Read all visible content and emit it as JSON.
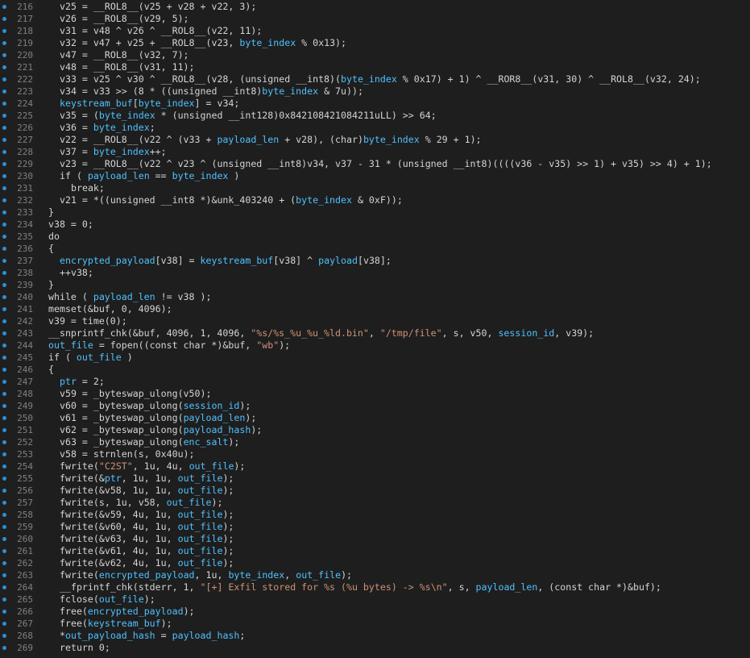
{
  "editor": {
    "colors": {
      "background": "#1e1e1e",
      "default_text": "#d4d4d4",
      "variable_highlight": "#4fc1ff",
      "string_literal": "#ce9178",
      "line_number": "#808080",
      "breakpoint_dot": "#2d8fd5"
    },
    "gutter_marker_icon": "dot-icon",
    "lines": [
      {
        "num": "216",
        "indent": 1,
        "segs": [
          [
            "",
            "v25 = __ROL8__(v25 + v28 + v22, 3);"
          ]
        ]
      },
      {
        "num": "217",
        "indent": 1,
        "segs": [
          [
            "",
            "v26 = __ROL8__(v29, 5);"
          ]
        ]
      },
      {
        "num": "218",
        "indent": 1,
        "segs": [
          [
            "",
            "v31 = v48 ^ v26 ^ __ROL8__(v22, 11);"
          ]
        ]
      },
      {
        "num": "219",
        "indent": 1,
        "segs": [
          [
            "",
            "v32 = v47 + v25 + __ROL8__(v23, "
          ],
          [
            "v",
            "byte_index"
          ],
          [
            "",
            " % 0x13);"
          ]
        ]
      },
      {
        "num": "220",
        "indent": 1,
        "segs": [
          [
            "",
            "v47 = __ROL8__(v32, 7);"
          ]
        ]
      },
      {
        "num": "221",
        "indent": 1,
        "segs": [
          [
            "",
            "v48 = __ROL8__(v31, 11);"
          ]
        ]
      },
      {
        "num": "222",
        "indent": 1,
        "segs": [
          [
            "",
            "v33 = v25 ^ v30 ^ __ROL8__(v28, (unsigned __int8)("
          ],
          [
            "v",
            "byte_index"
          ],
          [
            "",
            " % 0x17) + 1) ^ __ROR8__(v31, 30) ^ __ROL8__(v32, 24);"
          ]
        ]
      },
      {
        "num": "223",
        "indent": 1,
        "segs": [
          [
            "",
            "v34 = v33 >> (8 * ((unsigned __int8)"
          ],
          [
            "v",
            "byte_index"
          ],
          [
            "",
            " & 7u));"
          ]
        ]
      },
      {
        "num": "224",
        "indent": 1,
        "segs": [
          [
            "v",
            "keystream_buf"
          ],
          [
            "",
            "["
          ],
          [
            "v",
            "byte_index"
          ],
          [
            "",
            "] = v34;"
          ]
        ]
      },
      {
        "num": "225",
        "indent": 1,
        "segs": [
          [
            "",
            "v35 = ("
          ],
          [
            "v",
            "byte_index"
          ],
          [
            "",
            " * (unsigned __int128)0x842108421084211uLL) >> 64;"
          ]
        ]
      },
      {
        "num": "226",
        "indent": 1,
        "segs": [
          [
            "",
            "v36 = "
          ],
          [
            "v",
            "byte_index"
          ],
          [
            "",
            ";"
          ]
        ]
      },
      {
        "num": "227",
        "indent": 1,
        "segs": [
          [
            "",
            "v22 = __ROL8__(v22 ^ (v33 + "
          ],
          [
            "v",
            "payload_len"
          ],
          [
            "",
            " + v28), (char)"
          ],
          [
            "v",
            "byte_index"
          ],
          [
            "",
            " % 29 + 1);"
          ]
        ]
      },
      {
        "num": "228",
        "indent": 1,
        "segs": [
          [
            "",
            "v37 = "
          ],
          [
            "v",
            "byte_index"
          ],
          [
            "",
            "++;"
          ]
        ]
      },
      {
        "num": "229",
        "indent": 1,
        "segs": [
          [
            "",
            "v23 = __ROL8__(v22 ^ v23 ^ (unsigned __int8)v34, v37 - 31 * (unsigned __int8)((((v36 - v35) >> 1) + v35) >> 4) + 1);"
          ]
        ]
      },
      {
        "num": "230",
        "indent": 1,
        "segs": [
          [
            "",
            "if ( "
          ],
          [
            "v",
            "payload_len"
          ],
          [
            "",
            " == "
          ],
          [
            "v",
            "byte_index"
          ],
          [
            "",
            " )"
          ]
        ]
      },
      {
        "num": "231",
        "indent": 2,
        "segs": [
          [
            "",
            "break;"
          ]
        ]
      },
      {
        "num": "232",
        "indent": 1,
        "segs": [
          [
            "",
            "v21 = *((unsigned __int8 *)&unk_403240 + ("
          ],
          [
            "v",
            "byte_index"
          ],
          [
            "",
            " & 0xF));"
          ]
        ]
      },
      {
        "num": "233",
        "indent": 0,
        "segs": [
          [
            "",
            "}"
          ]
        ]
      },
      {
        "num": "234",
        "indent": 0,
        "segs": [
          [
            "",
            "v38 = 0;"
          ]
        ]
      },
      {
        "num": "235",
        "indent": 0,
        "segs": [
          [
            "",
            "do"
          ]
        ]
      },
      {
        "num": "236",
        "indent": 0,
        "segs": [
          [
            "",
            "{"
          ]
        ]
      },
      {
        "num": "237",
        "indent": 1,
        "segs": [
          [
            "v",
            "encrypted_payload"
          ],
          [
            "",
            "[v38] = "
          ],
          [
            "v",
            "keystream_buf"
          ],
          [
            "",
            "[v38] ^ "
          ],
          [
            "v",
            "payload"
          ],
          [
            "",
            "[v38];"
          ]
        ]
      },
      {
        "num": "238",
        "indent": 1,
        "segs": [
          [
            "",
            "++v38;"
          ]
        ]
      },
      {
        "num": "239",
        "indent": 0,
        "segs": [
          [
            "",
            "}"
          ]
        ]
      },
      {
        "num": "240",
        "indent": 0,
        "segs": [
          [
            "",
            "while ( "
          ],
          [
            "v",
            "payload_len"
          ],
          [
            "",
            " != v38 );"
          ]
        ]
      },
      {
        "num": "241",
        "indent": 0,
        "segs": [
          [
            "",
            "memset(&buf, 0, 4096);"
          ]
        ]
      },
      {
        "num": "242",
        "indent": 0,
        "segs": [
          [
            "",
            "v39 = time(0);"
          ]
        ]
      },
      {
        "num": "243",
        "indent": 0,
        "segs": [
          [
            "",
            "__snprintf_chk(&buf, 4096, 1, 4096, "
          ],
          [
            "s",
            "\"%s/%s_%u_%u_%ld.bin\""
          ],
          [
            "",
            ", "
          ],
          [
            "s",
            "\"/tmp/file\""
          ],
          [
            "",
            ", s, v50, "
          ],
          [
            "v",
            "session_id"
          ],
          [
            "",
            ", v39);"
          ]
        ]
      },
      {
        "num": "244",
        "indent": 0,
        "segs": [
          [
            "v",
            "out_file"
          ],
          [
            "",
            " = fopen((const char *)&buf, "
          ],
          [
            "s",
            "\"wb\""
          ],
          [
            "",
            ");"
          ]
        ]
      },
      {
        "num": "245",
        "indent": 0,
        "segs": [
          [
            "",
            "if ( "
          ],
          [
            "v",
            "out_file"
          ],
          [
            "",
            " )"
          ]
        ]
      },
      {
        "num": "246",
        "indent": 0,
        "segs": [
          [
            "",
            "{"
          ]
        ]
      },
      {
        "num": "247",
        "indent": 1,
        "segs": [
          [
            "v",
            "ptr"
          ],
          [
            "",
            " = 2;"
          ]
        ]
      },
      {
        "num": "248",
        "indent": 1,
        "segs": [
          [
            "",
            "v59 = _byteswap_ulong(v50);"
          ]
        ]
      },
      {
        "num": "249",
        "indent": 1,
        "segs": [
          [
            "",
            "v60 = _byteswap_ulong("
          ],
          [
            "v",
            "session_id"
          ],
          [
            "",
            ");"
          ]
        ]
      },
      {
        "num": "250",
        "indent": 1,
        "segs": [
          [
            "",
            "v61 = _byteswap_ulong("
          ],
          [
            "v",
            "payload_len"
          ],
          [
            "",
            ");"
          ]
        ]
      },
      {
        "num": "251",
        "indent": 1,
        "segs": [
          [
            "",
            "v62 = _byteswap_ulong("
          ],
          [
            "v",
            "payload_hash"
          ],
          [
            "",
            ");"
          ]
        ]
      },
      {
        "num": "252",
        "indent": 1,
        "segs": [
          [
            "",
            "v63 = _byteswap_ulong("
          ],
          [
            "v",
            "enc_salt"
          ],
          [
            "",
            ");"
          ]
        ]
      },
      {
        "num": "253",
        "indent": 1,
        "segs": [
          [
            "",
            "v58 = strnlen(s, 0x40u);"
          ]
        ]
      },
      {
        "num": "254",
        "indent": 1,
        "segs": [
          [
            "",
            "fwrite("
          ],
          [
            "s",
            "\"C2ST\""
          ],
          [
            "",
            ", 1u, 4u, "
          ],
          [
            "v",
            "out_file"
          ],
          [
            "",
            ");"
          ]
        ]
      },
      {
        "num": "255",
        "indent": 1,
        "segs": [
          [
            "",
            "fwrite(&"
          ],
          [
            "v",
            "ptr"
          ],
          [
            "",
            ", 1u, 1u, "
          ],
          [
            "v",
            "out_file"
          ],
          [
            "",
            ");"
          ]
        ]
      },
      {
        "num": "256",
        "indent": 1,
        "segs": [
          [
            "",
            "fwrite(&v58, 1u, 1u, "
          ],
          [
            "v",
            "out_file"
          ],
          [
            "",
            ");"
          ]
        ]
      },
      {
        "num": "257",
        "indent": 1,
        "segs": [
          [
            "",
            "fwrite(s, 1u, v58, "
          ],
          [
            "v",
            "out_file"
          ],
          [
            "",
            ");"
          ]
        ]
      },
      {
        "num": "258",
        "indent": 1,
        "segs": [
          [
            "",
            "fwrite(&v59, 4u, 1u, "
          ],
          [
            "v",
            "out_file"
          ],
          [
            "",
            ");"
          ]
        ]
      },
      {
        "num": "259",
        "indent": 1,
        "segs": [
          [
            "",
            "fwrite(&v60, 4u, 1u, "
          ],
          [
            "v",
            "out_file"
          ],
          [
            "",
            ");"
          ]
        ]
      },
      {
        "num": "260",
        "indent": 1,
        "segs": [
          [
            "",
            "fwrite(&v63, 4u, 1u, "
          ],
          [
            "v",
            "out_file"
          ],
          [
            "",
            ");"
          ]
        ]
      },
      {
        "num": "261",
        "indent": 1,
        "segs": [
          [
            "",
            "fwrite(&v61, 4u, 1u, "
          ],
          [
            "v",
            "out_file"
          ],
          [
            "",
            ");"
          ]
        ]
      },
      {
        "num": "262",
        "indent": 1,
        "segs": [
          [
            "",
            "fwrite(&v62, 4u, 1u, "
          ],
          [
            "v",
            "out_file"
          ],
          [
            "",
            ");"
          ]
        ]
      },
      {
        "num": "263",
        "indent": 1,
        "segs": [
          [
            "",
            "fwrite("
          ],
          [
            "v",
            "encrypted_payload"
          ],
          [
            "",
            ", 1u, "
          ],
          [
            "v",
            "byte_index"
          ],
          [
            "",
            ", "
          ],
          [
            "v",
            "out_file"
          ],
          [
            "",
            ");"
          ]
        ]
      },
      {
        "num": "264",
        "indent": 1,
        "segs": [
          [
            "",
            "__fprintf_chk(stderr, 1, "
          ],
          [
            "s",
            "\"[+] Exfil stored for %s (%u bytes) -> %s\\n\""
          ],
          [
            "",
            ", s, "
          ],
          [
            "v",
            "payload_len"
          ],
          [
            "",
            ", (const char *)&buf);"
          ]
        ]
      },
      {
        "num": "265",
        "indent": 1,
        "segs": [
          [
            "",
            "fclose("
          ],
          [
            "v",
            "out_file"
          ],
          [
            "",
            ");"
          ]
        ]
      },
      {
        "num": "266",
        "indent": 1,
        "segs": [
          [
            "",
            "free("
          ],
          [
            "v",
            "encrypted_payload"
          ],
          [
            "",
            ");"
          ]
        ]
      },
      {
        "num": "267",
        "indent": 1,
        "segs": [
          [
            "",
            "free("
          ],
          [
            "v",
            "keystream_buf"
          ],
          [
            "",
            ");"
          ]
        ]
      },
      {
        "num": "268",
        "indent": 1,
        "segs": [
          [
            "",
            "*"
          ],
          [
            "v",
            "out_payload_hash"
          ],
          [
            "",
            " = "
          ],
          [
            "v",
            "payload_hash"
          ],
          [
            "",
            ";"
          ]
        ]
      },
      {
        "num": "269",
        "indent": 1,
        "segs": [
          [
            "",
            "return 0;"
          ]
        ]
      }
    ]
  }
}
